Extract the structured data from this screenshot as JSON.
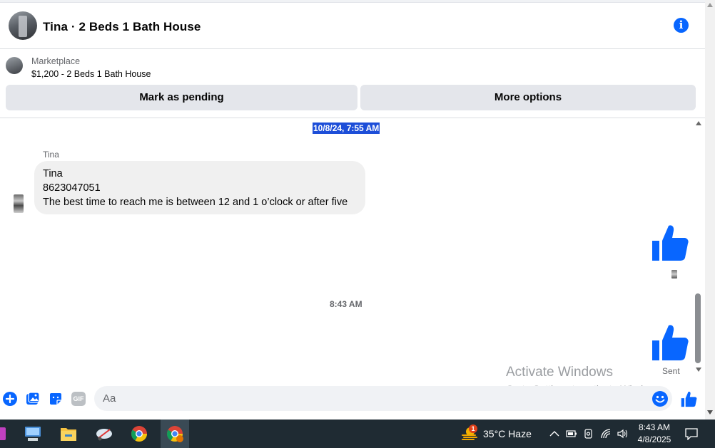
{
  "header": {
    "title": "Tina · 2 Beds 1 Bath House",
    "info_icon": "info-icon"
  },
  "marketplace": {
    "label": "Marketplace",
    "item": "$1,200 - 2 Beds 1 Bath House",
    "pending_button": "Mark as pending",
    "more_button": "More options"
  },
  "messages": {
    "timestamp_1": "10/8/24, 7:55 AM",
    "sender_name": "Tina",
    "bubble_lines": [
      "Tina",
      "8623047051",
      "The best time to reach me is between 12 and 1 o’clock or after five"
    ],
    "timestamp_2": "8:43 AM",
    "status": "Sent"
  },
  "watermark": {
    "line1": "Activate Windows",
    "line2": "Go to Settings to activate Windows."
  },
  "composer": {
    "placeholder": "Aa",
    "icons": [
      "plus-icon",
      "photo-icon",
      "sticker-icon",
      "gif-icon",
      "emoji-icon",
      "like-icon"
    ],
    "gif_label": "GIF"
  },
  "taskbar": {
    "weather_badge": "1",
    "weather": "35°C  Haze",
    "time": "8:43 AM",
    "date": "4/8/2025"
  },
  "colors": {
    "brand": "#0866ff",
    "highlight": "#1d4ed8",
    "taskbar": "#1f2b33"
  }
}
